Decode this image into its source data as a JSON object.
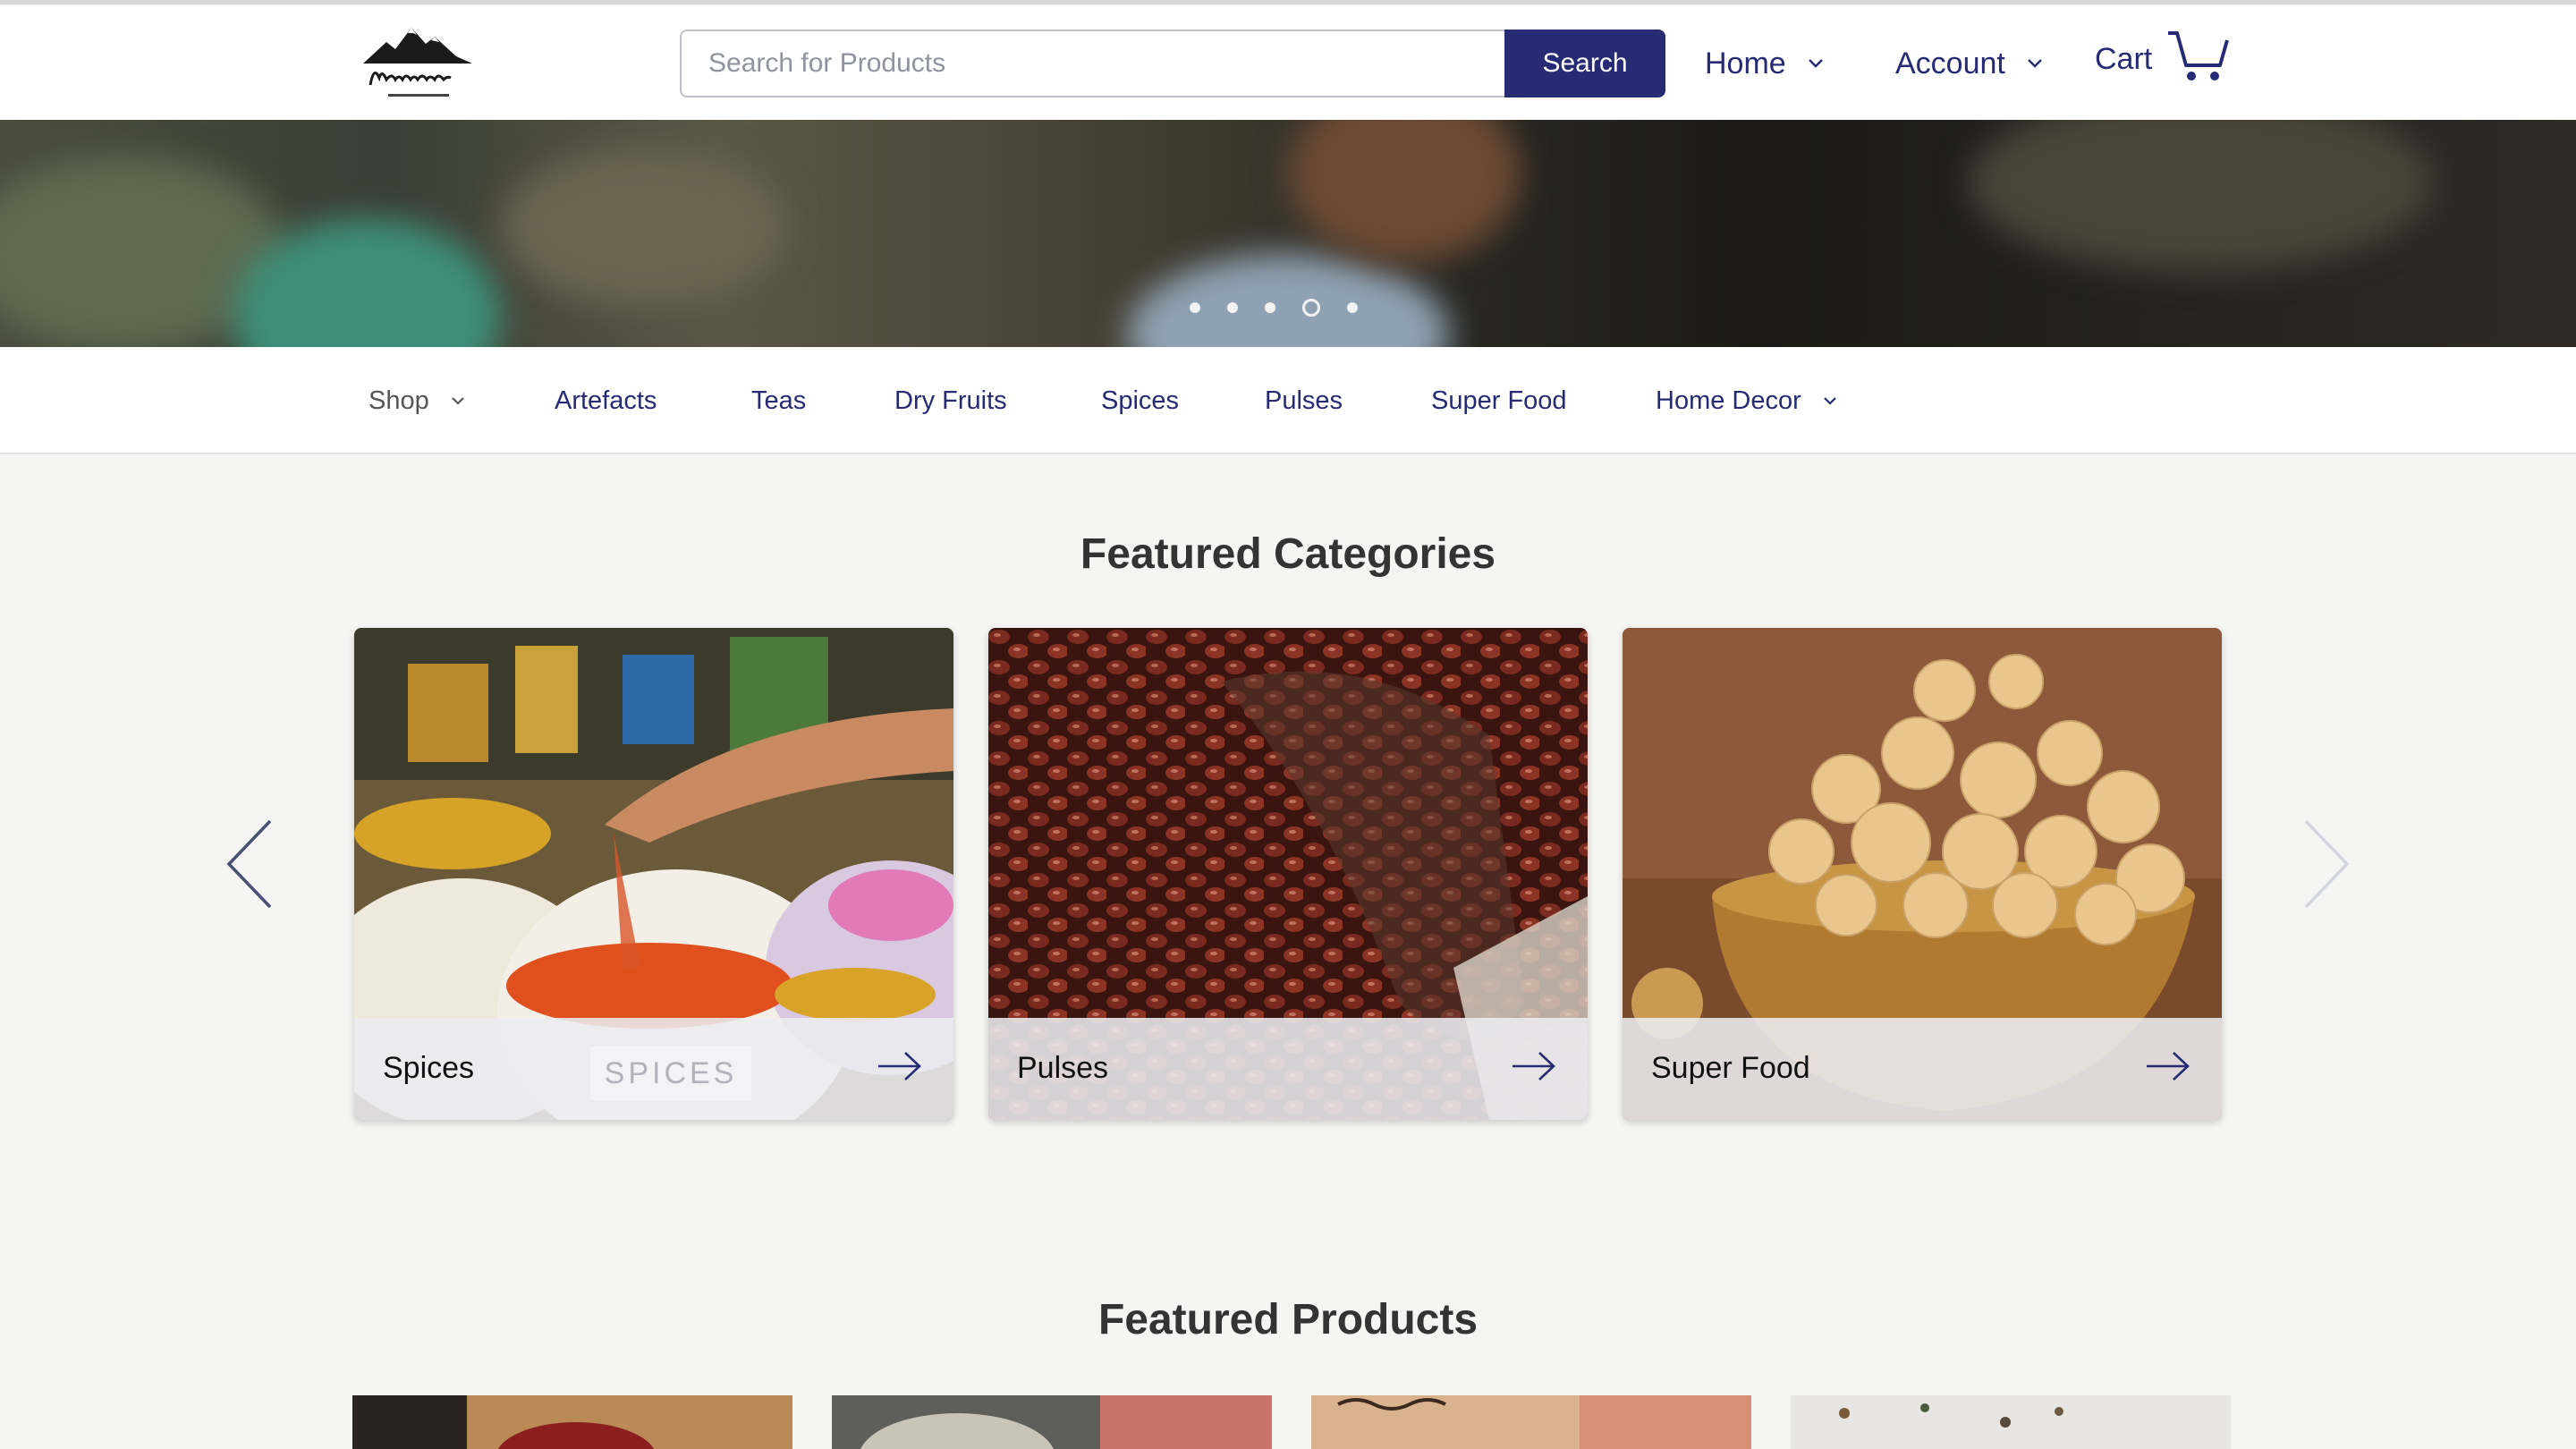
{
  "header": {
    "logo_icon": "kashmiriyat-mountain-logo",
    "search": {
      "placeholder": "Search for Products",
      "value": "",
      "button_label": "Search"
    },
    "nav": {
      "home_label": "Home",
      "account_label": "Account",
      "cart_label": "Cart"
    },
    "accent_color": "#262b73"
  },
  "hero": {
    "slide_count": 5,
    "active_slide": 4
  },
  "category_nav": {
    "items": [
      {
        "label": "Shop",
        "has_dropdown": true
      },
      {
        "label": "Artefacts",
        "has_dropdown": false
      },
      {
        "label": "Teas",
        "has_dropdown": false
      },
      {
        "label": "Dry Fruits",
        "has_dropdown": false
      },
      {
        "label": "Spices",
        "has_dropdown": false
      },
      {
        "label": "Pulses",
        "has_dropdown": false
      },
      {
        "label": "Super Food",
        "has_dropdown": false
      },
      {
        "label": "Home Decor",
        "has_dropdown": true
      }
    ]
  },
  "featured_categories": {
    "title": "Featured Categories",
    "cards": [
      {
        "label": "Spices",
        "watermark": "SPICES"
      },
      {
        "label": "Pulses"
      },
      {
        "label": "Super Food"
      }
    ],
    "prev_icon": "chevron-left-icon",
    "next_icon": "chevron-right-icon"
  },
  "featured_products": {
    "title": "Featured Products"
  }
}
